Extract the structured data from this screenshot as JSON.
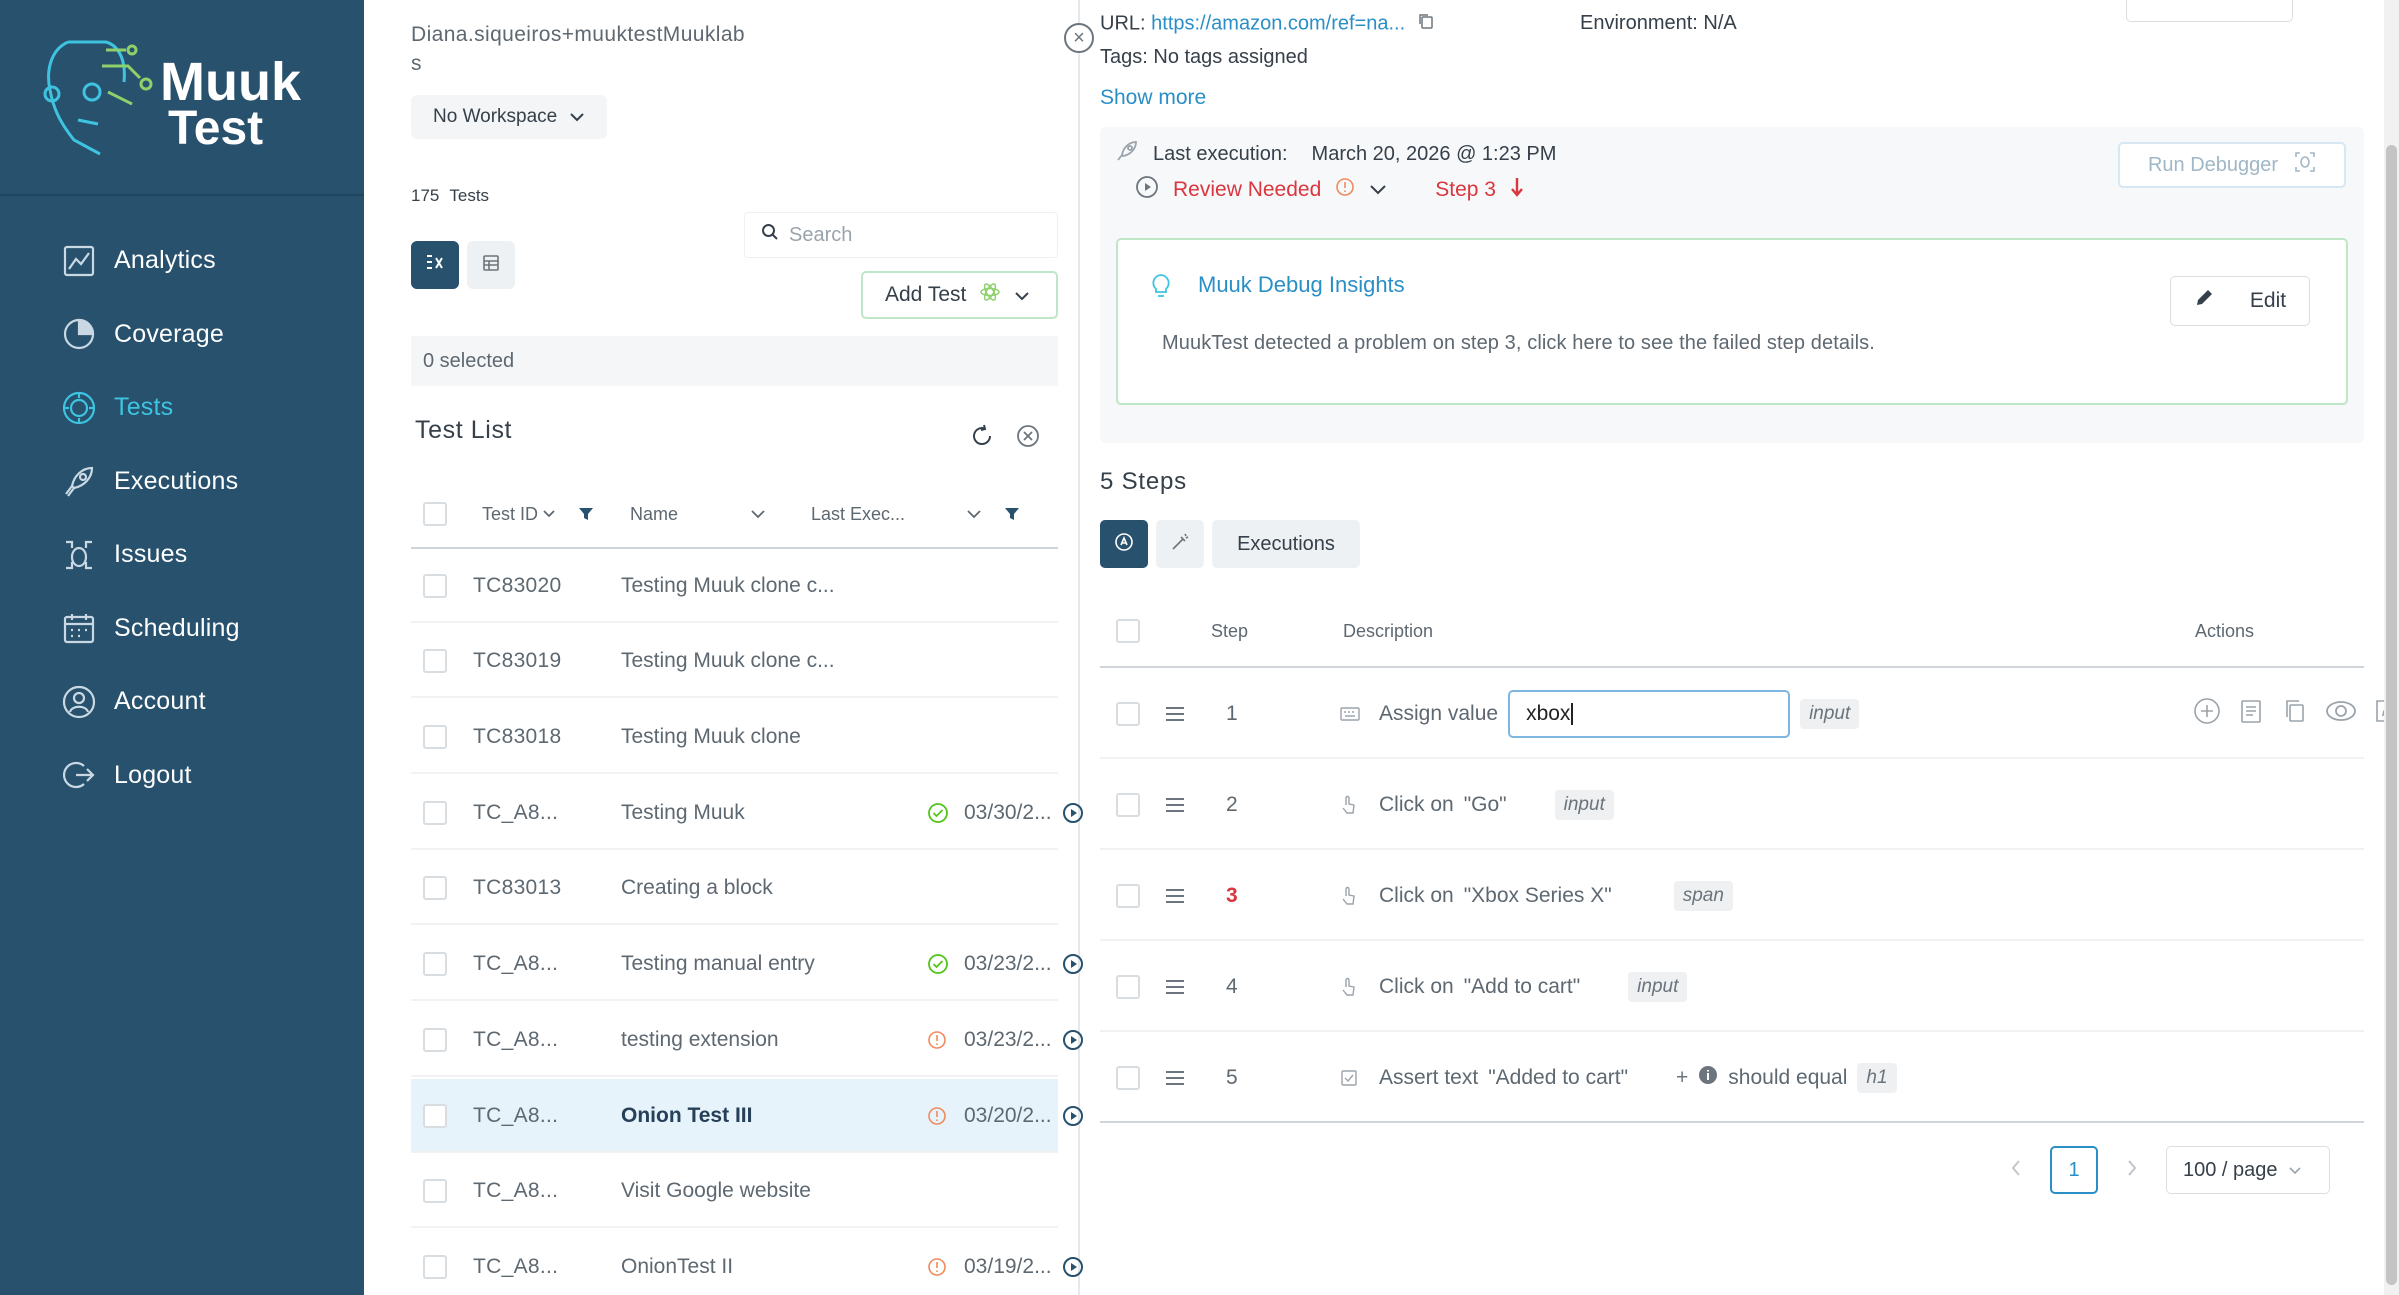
{
  "brand": {
    "name_line1": "Muuk",
    "name_line2": "Test"
  },
  "sidebar": {
    "items": [
      {
        "label": "Analytics",
        "icon": "analytics-icon"
      },
      {
        "label": "Coverage",
        "icon": "coverage-icon"
      },
      {
        "label": "Tests",
        "icon": "tests-icon",
        "active": true
      },
      {
        "label": "Executions",
        "icon": "rocket-icon"
      },
      {
        "label": "Issues",
        "icon": "bug-icon"
      },
      {
        "label": "Scheduling",
        "icon": "calendar-icon"
      },
      {
        "label": "Account",
        "icon": "user-icon"
      },
      {
        "label": "Logout",
        "icon": "logout-icon"
      }
    ]
  },
  "listpane": {
    "user": "Diana.siqueiros+muuktestMuuklabs",
    "workspace": "No Workspace",
    "test_count": "175",
    "test_count_label": "Tests",
    "search_placeholder": "Search",
    "add_test": "Add Test",
    "selected": "0 selected",
    "title": "Test List",
    "columns": {
      "id": "Test ID",
      "name": "Name",
      "last": "Last Exec..."
    },
    "rows": [
      {
        "id": "TC83020",
        "name": "Testing Muuk clone c...",
        "status": "",
        "date": ""
      },
      {
        "id": "TC83019",
        "name": "Testing Muuk clone c...",
        "status": "",
        "date": ""
      },
      {
        "id": "TC83018",
        "name": "Testing Muuk clone",
        "status": "",
        "date": ""
      },
      {
        "id": "TC_A8...",
        "name": "Testing Muuk",
        "status": "pass",
        "date": "03/30/2..."
      },
      {
        "id": "TC83013",
        "name": "Creating a block",
        "status": "",
        "date": ""
      },
      {
        "id": "TC_A8...",
        "name": "Testing manual entry",
        "status": "pass",
        "date": "03/23/2..."
      },
      {
        "id": "TC_A8...",
        "name": "testing extension",
        "status": "warn",
        "date": "03/23/2..."
      },
      {
        "id": "TC_A8...",
        "name": "Onion Test III",
        "status": "warn",
        "date": "03/20/2...",
        "selected": true
      },
      {
        "id": "TC_A8...",
        "name": "Visit Google website",
        "status": "",
        "date": ""
      },
      {
        "id": "TC_A8...",
        "name": "OnionTest II",
        "status": "warn",
        "date": "03/19/2..."
      }
    ]
  },
  "detail": {
    "url_label": "URL:",
    "url": "https://amazon.com/ref=na...",
    "environment": "Environment: N/A",
    "tags_label": "Tags:",
    "tags": "No tags assigned",
    "show_more": "Show more",
    "last_execution_label": "Last execution:",
    "last_execution_date": "March 20, 2026 @ 1:23 PM",
    "status": "Review Needed",
    "step_flag": "Step 3",
    "run_debugger": "Run Debugger",
    "insights_title": "Muuk Debug Insights",
    "insights_message": "MuukTest detected a problem on step 3, click here to see the failed step details.",
    "edit": "Edit",
    "steps_title": "5 Steps",
    "executions_tab": "Executions",
    "columns": {
      "step": "Step",
      "description": "Description",
      "actions": "Actions"
    },
    "steps": [
      {
        "num": "1",
        "action": "Assign value",
        "value": "xbox",
        "tag": "input"
      },
      {
        "num": "2",
        "action": "Click on",
        "target": "\"Go\"",
        "tag": "input"
      },
      {
        "num": "3",
        "action": "Click on",
        "target": "\"Xbox Series X\"",
        "tag": "span",
        "error": true
      },
      {
        "num": "4",
        "action": "Click on",
        "target": "\"Add to cart\"",
        "tag": "input"
      },
      {
        "num": "5",
        "action": "Assert text",
        "target": "\"Added to cart\"",
        "extra": "should equal",
        "tag": "h1"
      }
    ],
    "page": "1",
    "per_page": "100 / page",
    "accent": "#27516d",
    "link": "#2a8fc7",
    "error": "#d9363e"
  }
}
